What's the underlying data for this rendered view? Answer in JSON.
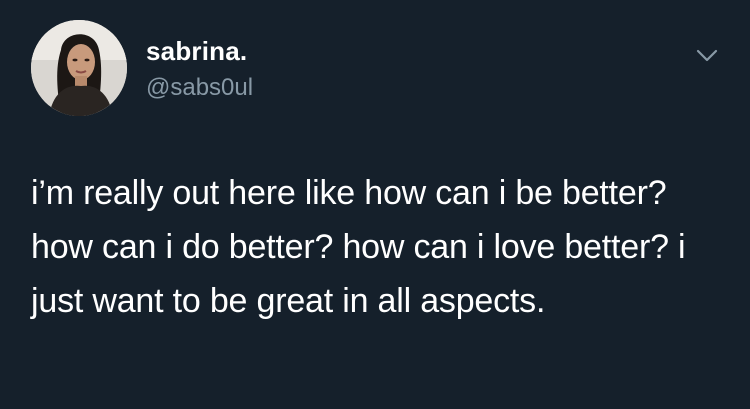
{
  "tweet": {
    "user": {
      "display_name": "sabrina.",
      "handle": "@sabs0ul",
      "avatar_icon": "profile-photo"
    },
    "text": "i’m really out here like how can i be better? how can i do better? how can i love better? i just want to be great in all aspects.",
    "menu_icon": "chevron-down-icon"
  },
  "colors": {
    "background": "#15202b",
    "primary_text": "#ffffff",
    "secondary_text": "#8899a6"
  }
}
